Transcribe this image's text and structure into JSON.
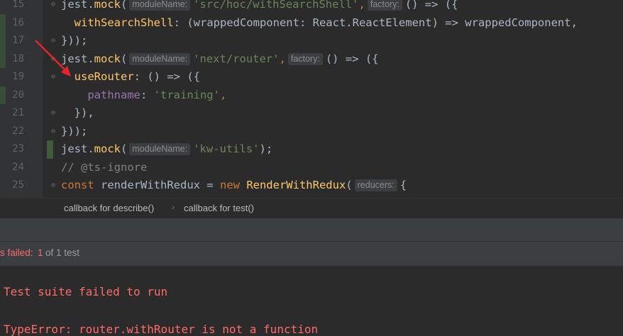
{
  "editor": {
    "lines": [
      {
        "num": "15"
      },
      {
        "num": "16"
      },
      {
        "num": "17"
      },
      {
        "num": "18"
      },
      {
        "num": "19"
      },
      {
        "num": "20"
      },
      {
        "num": "21"
      },
      {
        "num": "22"
      },
      {
        "num": "23"
      },
      {
        "num": "24"
      },
      {
        "num": "25"
      }
    ],
    "code": {
      "l15": {
        "jest": "jest",
        "mock": "mock",
        "open": "(",
        "hint": "moduleName:",
        "str": "'src/hoc/withSearchShell'",
        "comma": ",",
        "hint2": "factory:",
        "rest": "() => ({"
      },
      "l16": {
        "fn": "withSearchShell",
        "rest": ": (wrappedComponent: React.ReactElement) => wrappedComponent,"
      },
      "l17": {
        "text": "}));"
      },
      "l18": {
        "jest": "jest",
        "mock": "mock",
        "open": "(",
        "hint": "moduleName:",
        "str": "'next/router'",
        "comma": ",",
        "hint2": "factory:",
        "rest": "() => ({"
      },
      "l19": {
        "fn": "useRouter",
        "rest": ": () => ({"
      },
      "l20": {
        "prop": "pathname",
        "colon": ": ",
        "str": "'training'",
        "comma": ","
      },
      "l21": {
        "text": "}),"
      },
      "l22": {
        "text": "}));"
      },
      "l23": {
        "jest": "jest",
        "mock": "mock",
        "open": "(",
        "hint": "moduleName:",
        "str": "'kw-utils'",
        "close": ");"
      },
      "l24": {
        "cmt": "// @ts-ignore"
      },
      "l25": {
        "kw": "const",
        "var": " renderWithRedux = ",
        "kw2": "new",
        "cls": " RenderWithRedux",
        "open": "(",
        "hint": "reducers:",
        "rest": "{"
      }
    }
  },
  "breadcrumbs": {
    "item1": "callback for describe()",
    "item2": "callback for test()"
  },
  "status": {
    "failed_label": "s failed:",
    "count": "1",
    "of_text": "of 1 test"
  },
  "console": {
    "line1": "Test suite failed to run",
    "line2": "TypeError: router.withRouter is not a function"
  },
  "colors": {
    "background": "#2b2b2b",
    "error_red": "#ff6b68",
    "string_green": "#6a8759",
    "function_yellow": "#ffc66d",
    "keyword_orange": "#cc7832",
    "annotation_arrow": "#e8242a"
  }
}
